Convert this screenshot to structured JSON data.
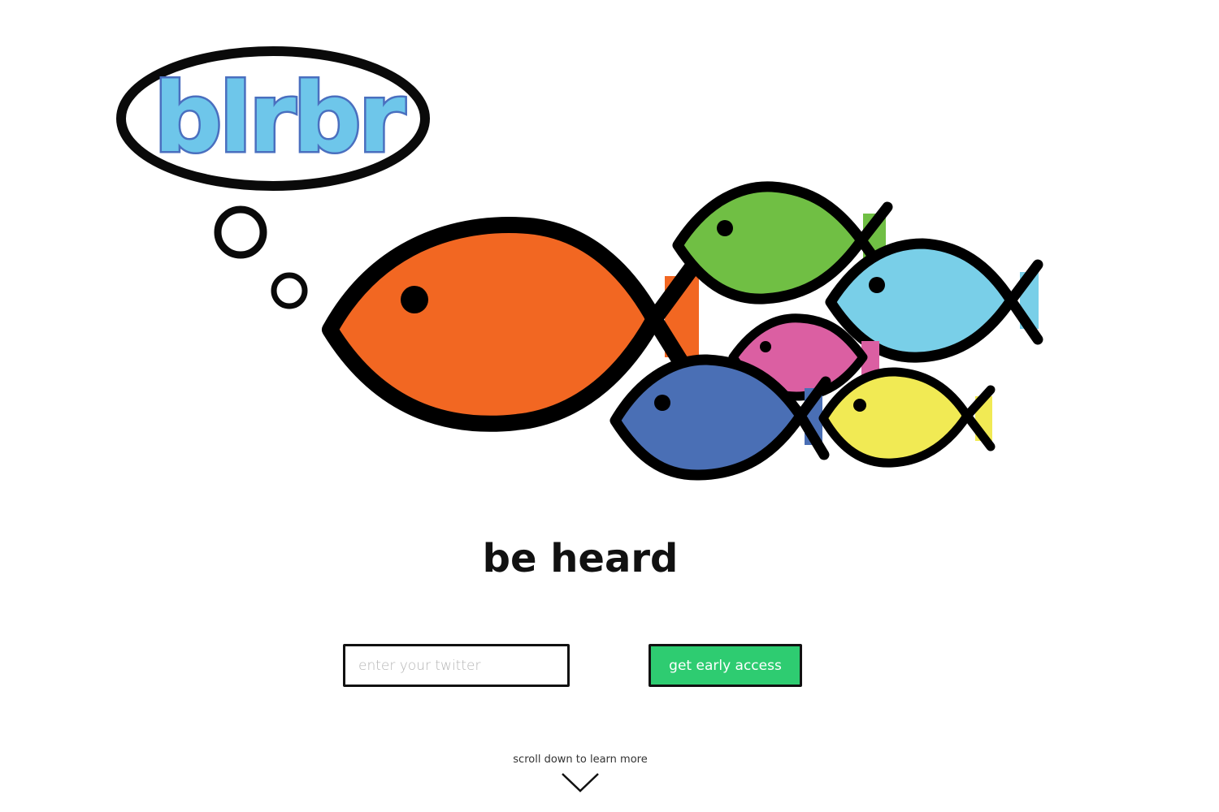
{
  "brand": {
    "logo_text": "blrbr",
    "logo_fill": "#6ec6ea",
    "logo_outline": "#4a6fbf"
  },
  "hero": {
    "tagline": "be heard",
    "fish_colors": [
      "#f26722",
      "#70bf44",
      "#79cfe8",
      "#db5fa2",
      "#4a6fb5",
      "#f1ea54"
    ]
  },
  "signup": {
    "twitter_placeholder": "enter your twitter",
    "twitter_value": "",
    "button_label": "get early access",
    "button_color": "#2ecc71"
  },
  "footer": {
    "scroll_hint": "scroll down to learn more",
    "scroll_icon": "chevron-down-icon"
  }
}
